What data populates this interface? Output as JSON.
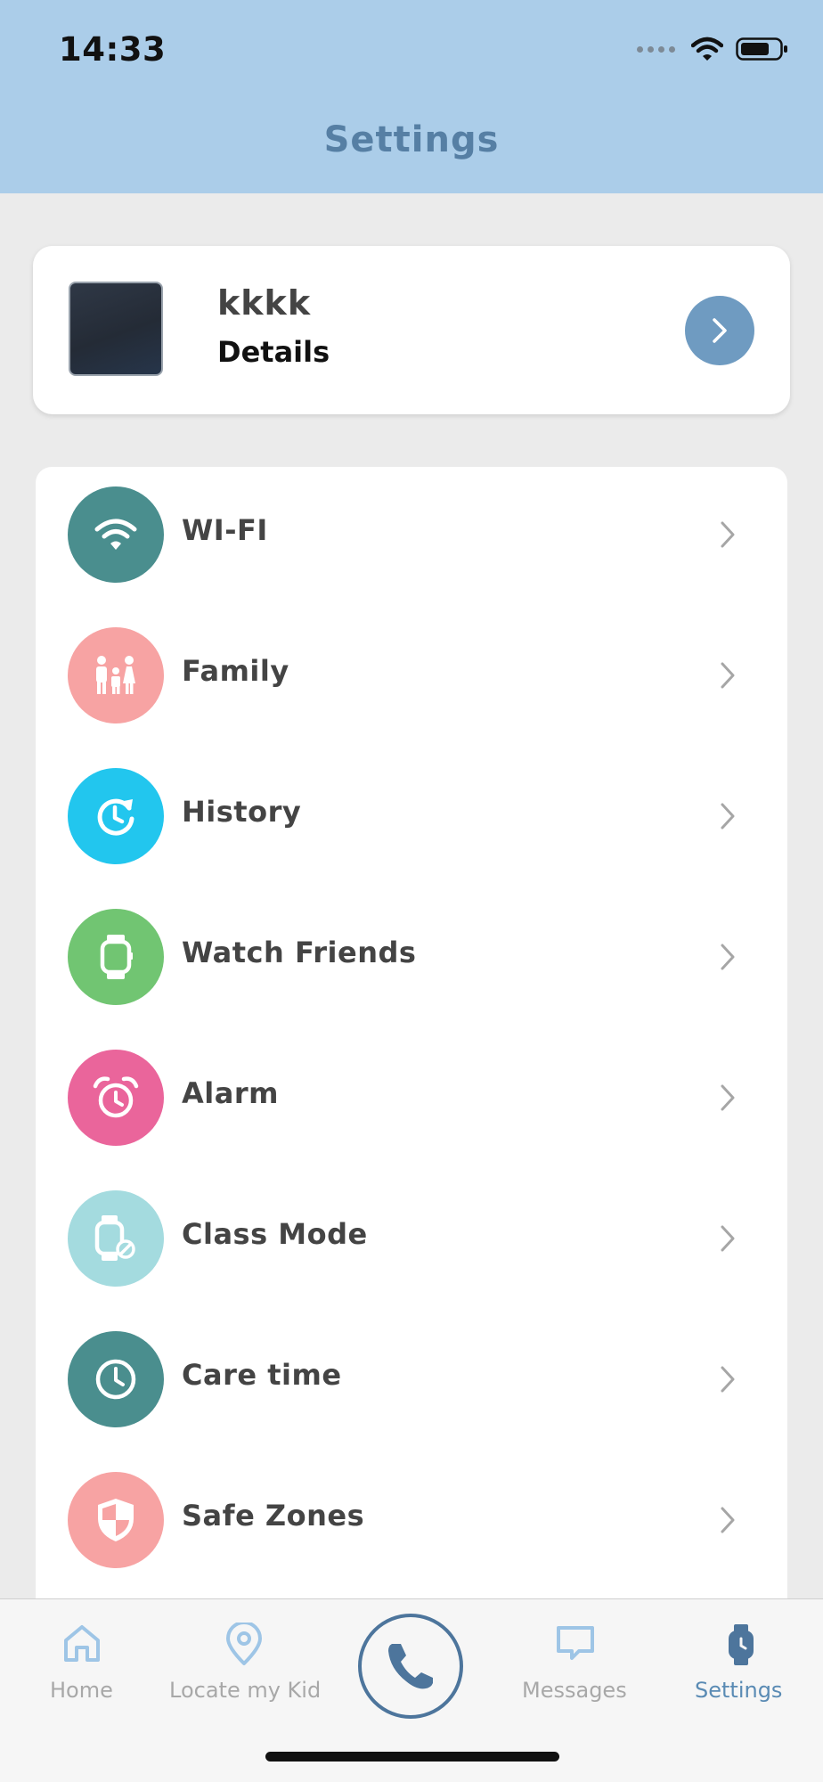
{
  "status_bar": {
    "time": "14:33"
  },
  "header": {
    "title": "Settings"
  },
  "profile": {
    "name": "kkkk",
    "details_label": "Details"
  },
  "settings_items": [
    {
      "label": "WI-FI",
      "icon": "wifi-icon",
      "color": "#4a8e8e"
    },
    {
      "label": "Family",
      "icon": "family-icon",
      "color": "#f7a3a3"
    },
    {
      "label": "History",
      "icon": "history-icon",
      "color": "#22c6ee"
    },
    {
      "label": "Watch Friends",
      "icon": "watch-icon",
      "color": "#71c572"
    },
    {
      "label": "Alarm",
      "icon": "alarm-clock-icon",
      "color": "#ea659b"
    },
    {
      "label": "Class Mode",
      "icon": "class-mode-watch-icon",
      "color": "#a4dbdf"
    },
    {
      "label": "Care time",
      "icon": "clock-icon",
      "color": "#4a8e8e"
    },
    {
      "label": "Safe Zones",
      "icon": "shield-icon",
      "color": "#f7a3a3"
    }
  ],
  "tabs": [
    {
      "label": "Home",
      "icon": "home-icon"
    },
    {
      "label": "Locate my Kid",
      "icon": "location-pin-icon"
    },
    {
      "label": "Messages",
      "icon": "chat-bubble-icon"
    },
    {
      "label": "Settings",
      "icon": "watch-settings-icon",
      "active": true
    }
  ],
  "colors": {
    "header_bg": "#abcde9",
    "title": "#567fa4",
    "accent": "#6f9bc1",
    "tab_active": "#5a8bb4",
    "tab_inactive": "#a8a8a8"
  }
}
